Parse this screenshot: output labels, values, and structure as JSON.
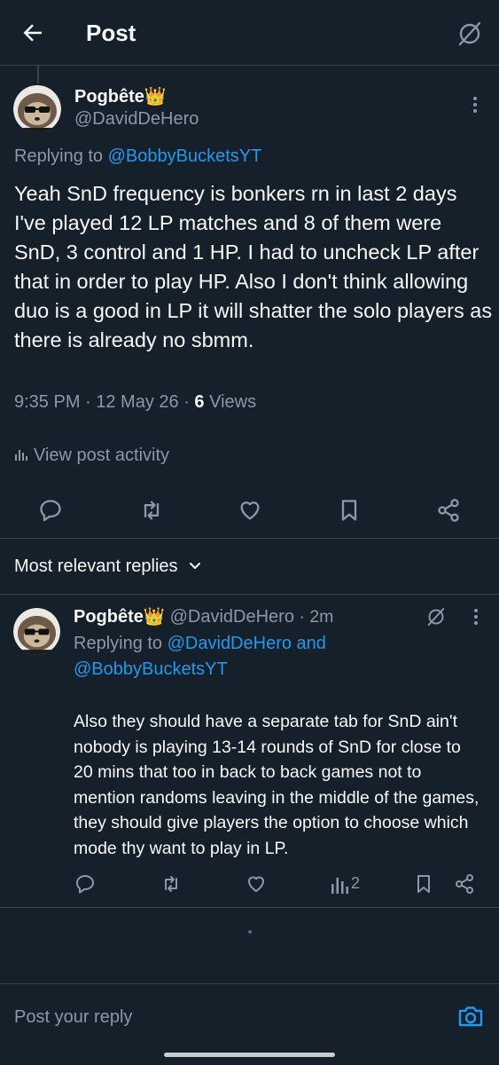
{
  "header": {
    "title": "Post"
  },
  "post": {
    "author_name": "Pogbête",
    "author_badge": "👑",
    "author_handle": "@DavidDeHero",
    "replying_prefix": "Replying to",
    "replying_to": "@BobbyBucketsYT",
    "text": "Yeah SnD frequency is bonkers rn in last 2 days I've played 12 LP matches and 8 of them were SnD, 3 control and 1 HP. I had to uncheck LP after that in order to play HP. Also I don't think allowing duo is a good in LP it will shatter the solo players as there is already no sbmm.",
    "time": "9:35 PM · 12 May 26 · ",
    "views_count": "6",
    "views_label": " Views",
    "activity_label": "View post activity"
  },
  "sort": {
    "label": "Most relevant replies"
  },
  "reply": {
    "author_name": "Pogbête",
    "author_badge": "👑",
    "author_handle": "@DavidDeHero",
    "separator": " · ",
    "age": "2m",
    "replying_prefix": "Replying to ",
    "replying_to_1": "@DavidDeHero",
    "replying_and": " and",
    "replying_to_2": "@BobbyBucketsYT",
    "text": "Also they should have a separate tab for SnD ain't nobody is playing 13-14 rounds of SnD for close to 20 mins that too in back to back games not to mention randoms leaving in the middle of the games, they should give players the option to choose which mode thy want to play in LP.",
    "views_count": "2"
  },
  "composer": {
    "placeholder": "Post your reply"
  },
  "colors": {
    "background": "#15202b",
    "accent": "#1d9bf0",
    "muted": "#8b98a5",
    "border": "#38444d"
  }
}
